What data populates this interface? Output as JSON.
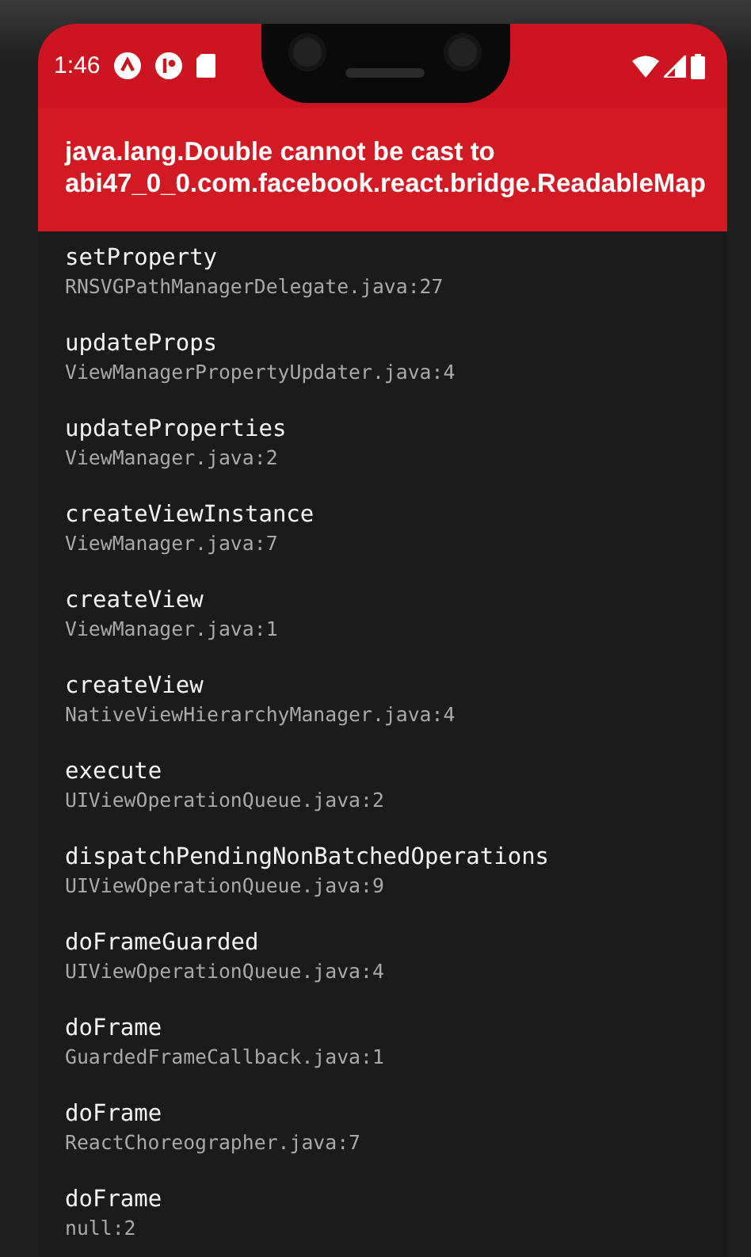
{
  "status_bar": {
    "time": "1:46"
  },
  "error": {
    "message": "java.lang.Double cannot be cast to\nabi47_0_0.com.facebook.react.bridge.ReadableMap"
  },
  "stack_frames": [
    {
      "method": "setProperty",
      "location": "RNSVGPathManagerDelegate.java:27"
    },
    {
      "method": "updateProps",
      "location": "ViewManagerPropertyUpdater.java:4"
    },
    {
      "method": "updateProperties",
      "location": "ViewManager.java:2"
    },
    {
      "method": "createViewInstance",
      "location": "ViewManager.java:7"
    },
    {
      "method": "createView",
      "location": "ViewManager.java:1"
    },
    {
      "method": "createView",
      "location": "NativeViewHierarchyManager.java:4"
    },
    {
      "method": "execute",
      "location": "UIViewOperationQueue.java:2"
    },
    {
      "method": "dispatchPendingNonBatchedOperations",
      "location": "UIViewOperationQueue.java:9"
    },
    {
      "method": "doFrameGuarded",
      "location": "UIViewOperationQueue.java:4"
    },
    {
      "method": "doFrame",
      "location": "GuardedFrameCallback.java:1"
    },
    {
      "method": "doFrame",
      "location": "ReactChoreographer.java:7"
    },
    {
      "method": "doFrame",
      "location": "null:2"
    }
  ]
}
